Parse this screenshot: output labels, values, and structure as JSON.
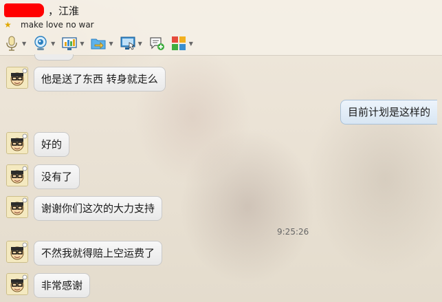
{
  "contact": {
    "name_suffix": "，江淮",
    "signature": "make love no war"
  },
  "toolbar": [
    {
      "icon": "microphone-icon"
    },
    {
      "icon": "webcam-icon"
    },
    {
      "icon": "screen-share-icon"
    },
    {
      "icon": "send-file-icon"
    },
    {
      "icon": "remote-desktop-icon"
    },
    {
      "icon": "new-discussion-icon"
    },
    {
      "icon": "apps-grid-icon"
    }
  ],
  "messages": [
    {
      "side": "left",
      "text": "他是送了东西 转身就走么"
    },
    {
      "side": "right",
      "text": "目前计划是这样的"
    },
    {
      "side": "left",
      "text": "好的"
    },
    {
      "side": "left",
      "text": "没有了"
    },
    {
      "side": "left",
      "text": "谢谢你们这次的大力支持"
    },
    {
      "side": "center-time",
      "text": "9:25:26"
    },
    {
      "side": "left",
      "text": "不然我就得赔上空运费了"
    },
    {
      "side": "left",
      "text": "非常感谢"
    }
  ]
}
